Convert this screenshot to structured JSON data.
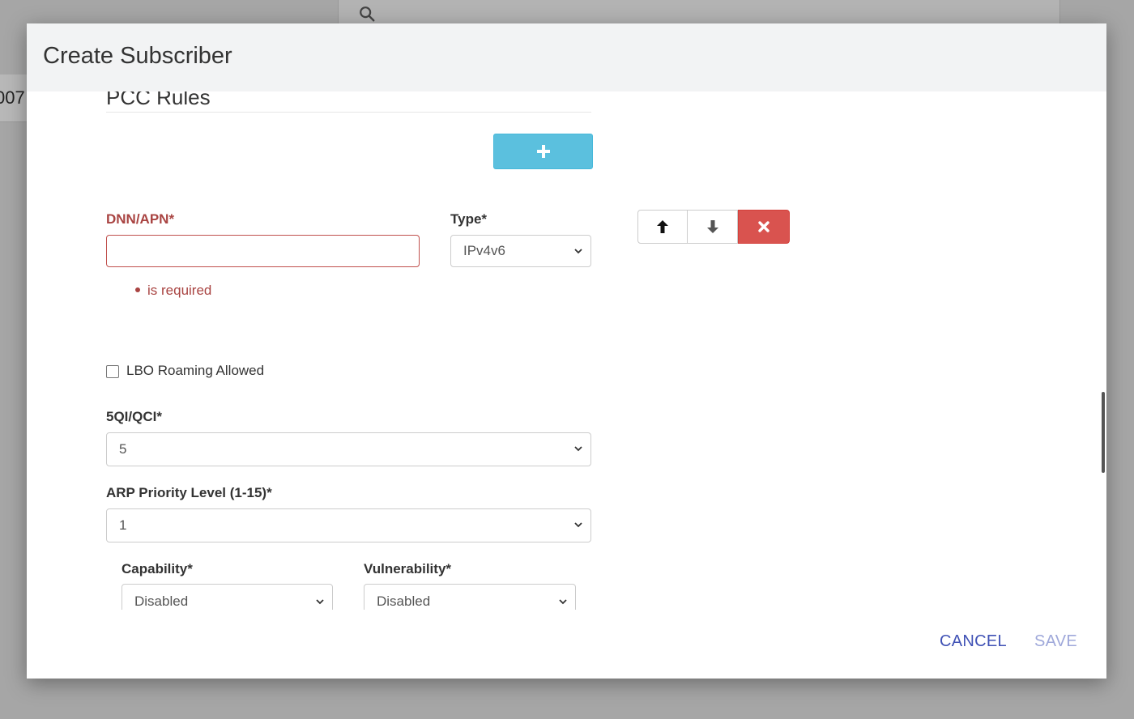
{
  "background": {
    "row_fragment": "007"
  },
  "dialog": {
    "title": "Create Subscriber",
    "section_title": "PCC Rules",
    "dnn": {
      "label": "DNN/APN*",
      "value": "",
      "error": "is required"
    },
    "type": {
      "label": "Type*",
      "value": "IPv4v6"
    },
    "lbo": {
      "label": "LBO Roaming Allowed",
      "checked": false
    },
    "qci": {
      "label": "5QI/QCI*",
      "value": "5"
    },
    "arp": {
      "label": "ARP Priority Level (1-15)*",
      "value": "1"
    },
    "capability": {
      "label": "Capability*",
      "value": "Disabled"
    },
    "vulnerability": {
      "label": "Vulnerability*",
      "value": "Disabled"
    },
    "footer": {
      "cancel": "CANCEL",
      "save": "SAVE"
    }
  },
  "colors": {
    "add_button": "#5bc0de",
    "error": "#a94442",
    "danger": "#d9534f",
    "primary": "#3f51b5",
    "primary_disabled": "#9fa8da"
  },
  "icons": {
    "add": "plus-icon",
    "up": "arrow-up-icon",
    "down": "arrow-down-icon",
    "remove": "close-icon",
    "search": "search-icon",
    "dropdown": "chevron-down-icon"
  }
}
